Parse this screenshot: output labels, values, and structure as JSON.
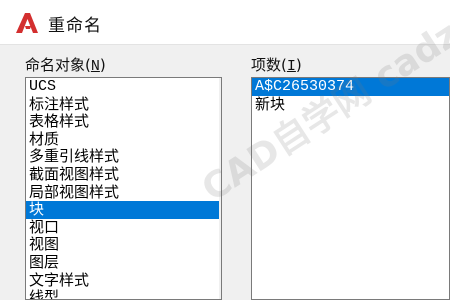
{
  "window": {
    "title": "重命名",
    "icon": "autocad-logo-icon"
  },
  "left_group": {
    "label": "命名对象",
    "mnemonic": "N",
    "items": [
      "UCS",
      "标注样式",
      "表格样式",
      "材质",
      "多重引线样式",
      "截面视图样式",
      "局部视图样式",
      "块",
      "视口",
      "视图",
      "图层",
      "文字样式",
      "线型"
    ],
    "selected_index": 7
  },
  "right_group": {
    "label": "项数",
    "mnemonic": "I",
    "items": [
      "A$C26530374",
      "新块"
    ],
    "selected_index": 0
  },
  "watermark": "CAD自学网 cadzxw.com",
  "colors": {
    "selection": "#0078d7",
    "logo": "#d32f2f"
  }
}
